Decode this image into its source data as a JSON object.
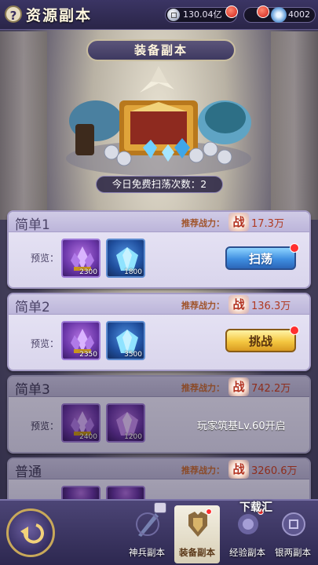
{
  "header": {
    "help_icon": "?",
    "title": "资源副本",
    "silver_amount": "130.04亿",
    "gem_amount": "4002"
  },
  "banner": {
    "title": "装备副本",
    "free_sweep_text": "今日免费扫荡次数：2"
  },
  "stages": [
    {
      "name": "简单1",
      "power_label": "推荐战力：",
      "power_icon": "战",
      "power": "17.3万",
      "preview_label": "预览：",
      "rewards": [
        {
          "icon": "purple-crystal-icon",
          "qty": "2300"
        },
        {
          "icon": "blue-gem-icon",
          "qty": "1800"
        }
      ],
      "action_label": "扫荡",
      "state": "sweep"
    },
    {
      "name": "简单2",
      "power_label": "推荐战力：",
      "power_icon": "战",
      "power": "136.3万",
      "preview_label": "预览：",
      "rewards": [
        {
          "icon": "purple-crystal-icon",
          "qty": "2350"
        },
        {
          "icon": "blue-gem-icon",
          "qty": "3500"
        }
      ],
      "action_label": "挑战",
      "state": "challenge"
    },
    {
      "name": "简单3",
      "power_label": "推荐战力：",
      "power_icon": "战",
      "power": "742.2万",
      "preview_label": "预览：",
      "rewards": [
        {
          "icon": "purple-crystal-icon",
          "qty": "2400"
        },
        {
          "icon": "purple-gem-icon",
          "qty": "1200"
        }
      ],
      "unlock_text": "玩家筑基Lv.60开启",
      "state": "locked"
    },
    {
      "name": "普通",
      "power_label": "推荐战力：",
      "power_icon": "战",
      "power": "3260.6万",
      "state": "locked"
    }
  ],
  "bottom_nav": {
    "tabs": [
      {
        "label": "神兵副本",
        "icon": "sword-icon"
      },
      {
        "label": "装备副本",
        "icon": "armor-icon",
        "active": true
      },
      {
        "label": "经验副本",
        "icon": "exp-pill-icon"
      },
      {
        "label": "银两副本",
        "icon": "silver-coin-icon"
      }
    ],
    "watermark": "下载汇"
  },
  "colors": {
    "card_bg": "#e9e6f6",
    "locked_card_bg": "#aaa6b6",
    "sweep_button": "#3f8ee0",
    "challenge_button": "#f4c740",
    "power_text": "#b03a22"
  }
}
